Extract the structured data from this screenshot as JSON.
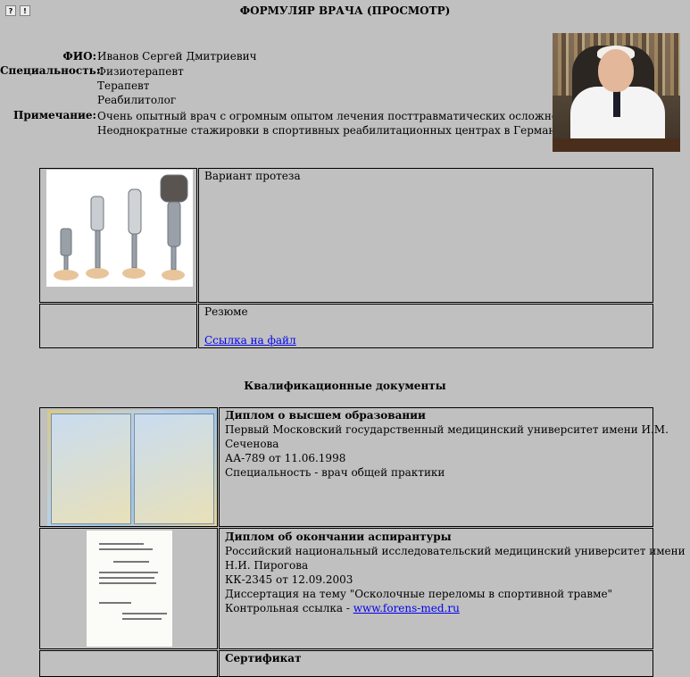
{
  "toolbar": {
    "help_label": "?",
    "alert_label": "!"
  },
  "title": "ФОРМУЛЯР ВРАЧА (ПРОСМОТР)",
  "doctor": {
    "fio_label": "ФИО:",
    "fio_value": "Иванов Сергей Дмитриевич",
    "specialty_label": "Специальность:",
    "specialties": [
      "Физиотерапевт",
      "Терапевт",
      "Реабилитолог"
    ],
    "note_label": "Примечание:",
    "note_lines": [
      "Очень опытный врач с огромным опытом лечения посттравматических осложнений.",
      "Неоднократные стажировки в спортивных реабилитационных центрах в Германии."
    ]
  },
  "attachments": {
    "prosthesis_caption": "Вариант протеза",
    "resume_caption": "Резюме",
    "file_link": "Ссылка на файл"
  },
  "qualifications": {
    "heading": "Квалификационные документы",
    "docs": [
      {
        "title": "Диплом о высшем образовании",
        "lines": [
          "Первый Московский государственный медицинский университет имени И.М.",
          "Сеченова",
          "АА-789 от 11.06.1998",
          "Специальность - врач общей практики"
        ]
      },
      {
        "title": "Диплом об окончании аспирантуры",
        "lines": [
          "Российский национальный исследовательский медицинский университет имени",
          "Н.И. Пирогова",
          "КК-2345 от 12.09.2003",
          "Диссертация на тему \"Осколочные переломы в спортивной травме\""
        ],
        "link_prefix": "Контрольная ссылка - ",
        "link_text": "www.forens-med.ru"
      },
      {
        "title": "Сертификат"
      }
    ]
  }
}
